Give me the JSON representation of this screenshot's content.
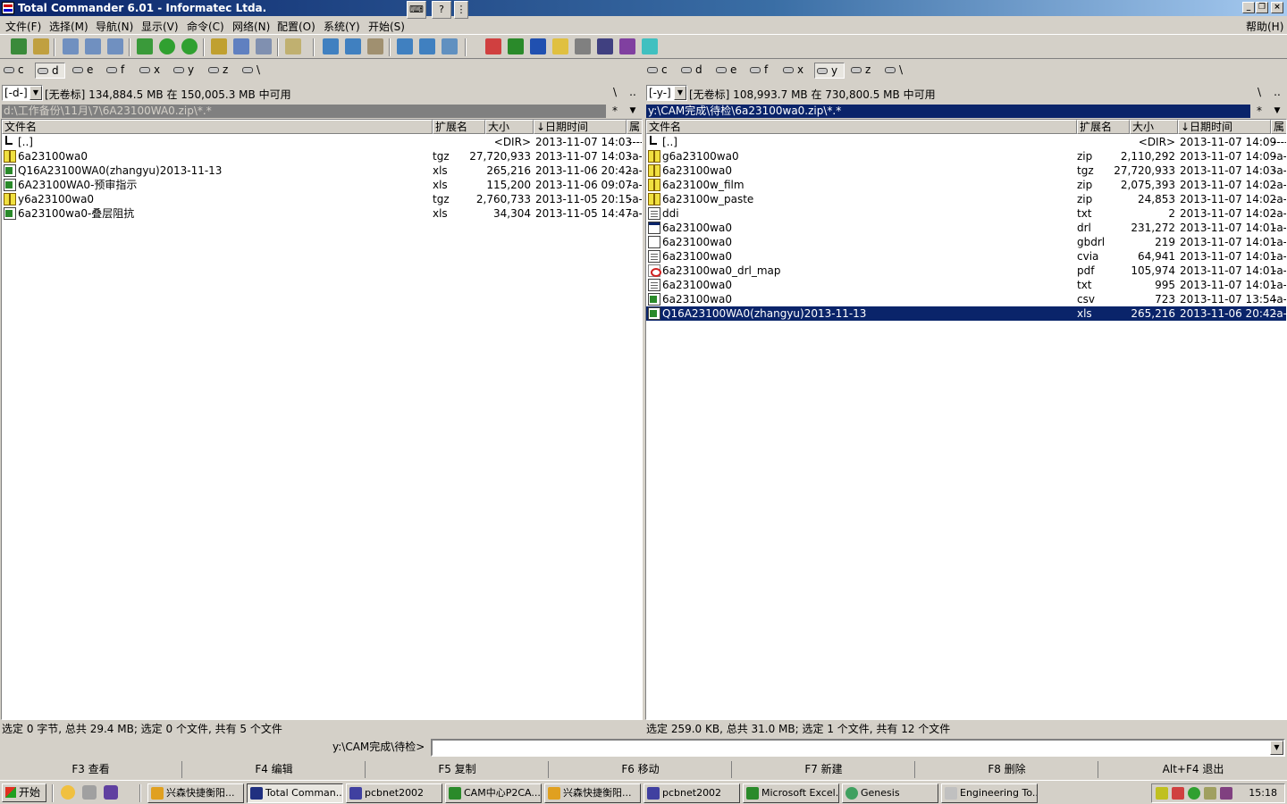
{
  "window": {
    "title": "Total Commander 6.01 - Informatec Ltda."
  },
  "menu": [
    "文件(F)",
    "选择(M)",
    "导航(N)",
    "显示(V)",
    "命令(C)",
    "网络(N)",
    "配置(O)",
    "系统(Y)",
    "开始(S)"
  ],
  "help_menu": "帮助(H)",
  "drives": [
    "c",
    "d",
    "e",
    "f",
    "x",
    "y",
    "z",
    "\\"
  ],
  "left": {
    "drive": "[-d-]",
    "free": "[无卷标]  134,884.5 MB 在 150,005.3 MB 中可用",
    "path": "d:\\工作备份\\11月\\7\\6A23100WA0.zip\\*.*",
    "columns": [
      "文件名",
      "扩展名",
      "大小",
      "↓日期时间",
      "属"
    ],
    "rows": [
      {
        "icon": "up",
        "name": "[..]",
        "ext": "",
        "size": "<DIR>",
        "date": "2013-11-07 14:03",
        "attr": "----"
      },
      {
        "icon": "arc",
        "name": "6a23100wa0",
        "ext": "tgz",
        "size": "27,720,933",
        "date": "2013-11-07 14:03",
        "attr": "-a-"
      },
      {
        "icon": "xls",
        "name": "Q16A23100WA0(zhangyu)2013-11-13",
        "ext": "xls",
        "size": "265,216",
        "date": "2013-11-06 20:42",
        "attr": "-a-"
      },
      {
        "icon": "xls",
        "name": "6A23100WA0-预审指示",
        "ext": "xls",
        "size": "115,200",
        "date": "2013-11-06 09:07",
        "attr": "-a-"
      },
      {
        "icon": "arc",
        "name": "y6a23100wa0",
        "ext": "tgz",
        "size": "2,760,733",
        "date": "2013-11-05 20:15",
        "attr": "-a-"
      },
      {
        "icon": "xls",
        "name": "6a23100wa0-叠层阻抗",
        "ext": "xls",
        "size": "34,304",
        "date": "2013-11-05 14:47",
        "attr": "-a-"
      }
    ],
    "status": "选定 0 字节, 总共 29.4 MB; 选定 0 个文件, 共有 5 个文件"
  },
  "right": {
    "drive": "[-y-]",
    "free": "[无卷标]  108,993.7 MB 在 730,800.5 MB 中可用",
    "path": "y:\\CAM完成\\待检\\6a23100wa0.zip\\*.*",
    "columns": [
      "文件名",
      "扩展名",
      "大小",
      "↓日期时间",
      "属"
    ],
    "rows": [
      {
        "icon": "up",
        "name": "[..]",
        "ext": "",
        "size": "<DIR>",
        "date": "2013-11-07 14:09",
        "attr": "----"
      },
      {
        "icon": "arc",
        "name": "g6a23100wa0",
        "ext": "zip",
        "size": "2,110,292",
        "date": "2013-11-07 14:09",
        "attr": "-a-"
      },
      {
        "icon": "arc",
        "name": "6a23100wa0",
        "ext": "tgz",
        "size": "27,720,933",
        "date": "2013-11-07 14:03",
        "attr": "-a-"
      },
      {
        "icon": "arc",
        "name": "6a23100w_film",
        "ext": "zip",
        "size": "2,075,393",
        "date": "2013-11-07 14:02",
        "attr": "-a-"
      },
      {
        "icon": "arc",
        "name": "6a23100w_paste",
        "ext": "zip",
        "size": "24,853",
        "date": "2013-11-07 14:02",
        "attr": "-a-"
      },
      {
        "icon": "txt",
        "name": "ddi",
        "ext": "txt",
        "size": "2",
        "date": "2013-11-07 14:02",
        "attr": "-a-"
      },
      {
        "icon": "exe",
        "name": "6a23100wa0",
        "ext": "drl",
        "size": "231,272",
        "date": "2013-11-07 14:01",
        "attr": "-a-"
      },
      {
        "icon": "gen",
        "name": "6a23100wa0",
        "ext": "gbdrl",
        "size": "219",
        "date": "2013-11-07 14:01",
        "attr": "-a-"
      },
      {
        "icon": "txt",
        "name": "6a23100wa0",
        "ext": "cvia",
        "size": "64,941",
        "date": "2013-11-07 14:01",
        "attr": "-a-"
      },
      {
        "icon": "pdf",
        "name": "6a23100wa0_drl_map",
        "ext": "pdf",
        "size": "105,974",
        "date": "2013-11-07 14:01",
        "attr": "-a-"
      },
      {
        "icon": "txt",
        "name": "6a23100wa0",
        "ext": "txt",
        "size": "995",
        "date": "2013-11-07 14:01",
        "attr": "-a-"
      },
      {
        "icon": "xls",
        "name": "6a23100wa0",
        "ext": "csv",
        "size": "723",
        "date": "2013-11-07 13:54",
        "attr": "-a-"
      },
      {
        "icon": "xls",
        "name": "Q16A23100WA0(zhangyu)2013-11-13",
        "ext": "xls",
        "size": "265,216",
        "date": "2013-11-06 20:42",
        "attr": "-a-",
        "selected": true
      }
    ],
    "status": "选定 259.0 KB, 总共 31.0 MB; 选定 1 个文件, 共有 12 个文件"
  },
  "cmdline": {
    "label": "y:\\CAM完成\\待检>",
    "value": ""
  },
  "fkeys": [
    "F3 查看",
    "F4 编辑",
    "F5 复制",
    "F6 移动",
    "F7 新建",
    "F8 删除",
    "Alt+F4 退出"
  ],
  "taskbar": {
    "start": "开始",
    "tasks": [
      "兴森快捷衡阳...",
      "Total Comman...",
      "pcbnet2002",
      "CAM中心P2CA...",
      "兴森快捷衡阳...",
      "pcbnet2002",
      "Microsoft Excel...",
      "Genesis",
      "Engineering To..."
    ],
    "active_index": 1,
    "clock": "15:18"
  }
}
